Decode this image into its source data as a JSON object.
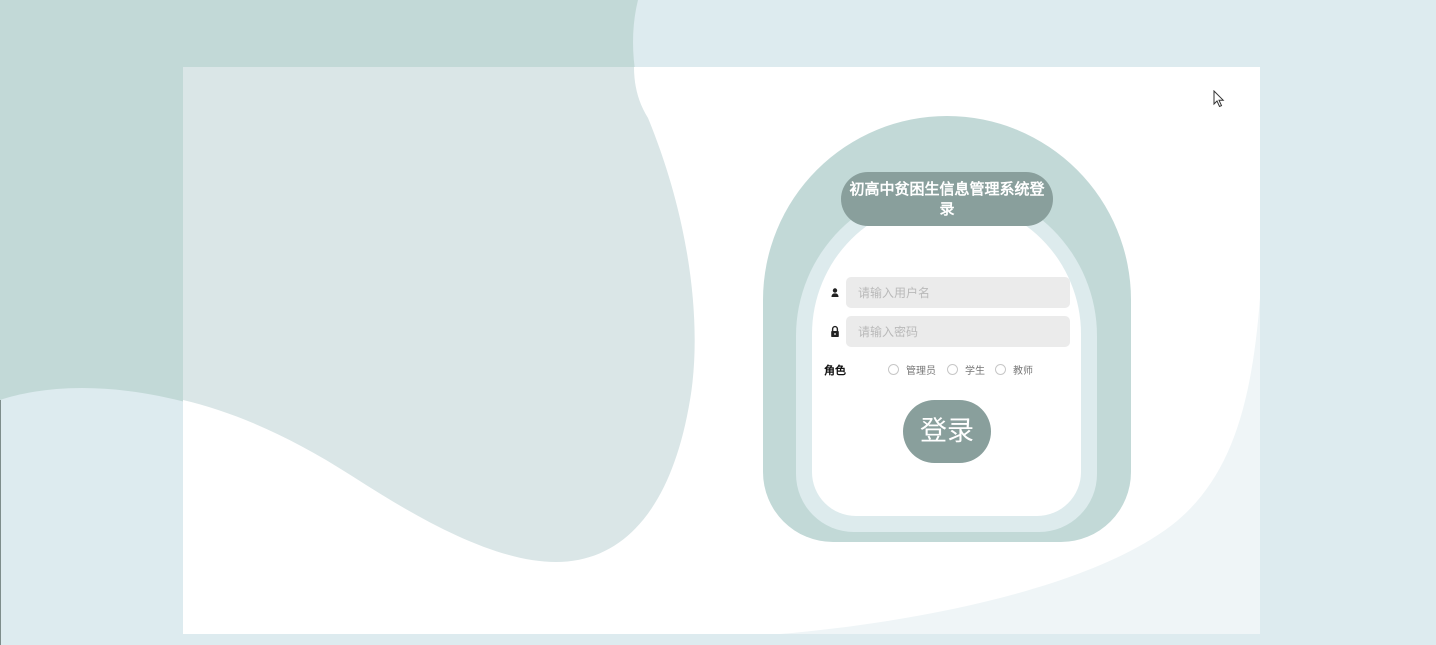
{
  "login": {
    "title": "初高中贫困生信息管理系统登录",
    "username_placeholder": "请输入用户名",
    "password_placeholder": "请输入密码",
    "role_label": "角色",
    "roles": [
      "管理员",
      "学生",
      "教师"
    ],
    "submit_label": "登录"
  },
  "icons": {
    "username": "user-icon",
    "password": "lock-icon",
    "cursor": "mouse-cursor-icon"
  },
  "colors": {
    "page_background": "#ddebef",
    "teal_blob": "#c2d9d7",
    "accent": "#899f9c",
    "input_background": "#ebebeb"
  }
}
